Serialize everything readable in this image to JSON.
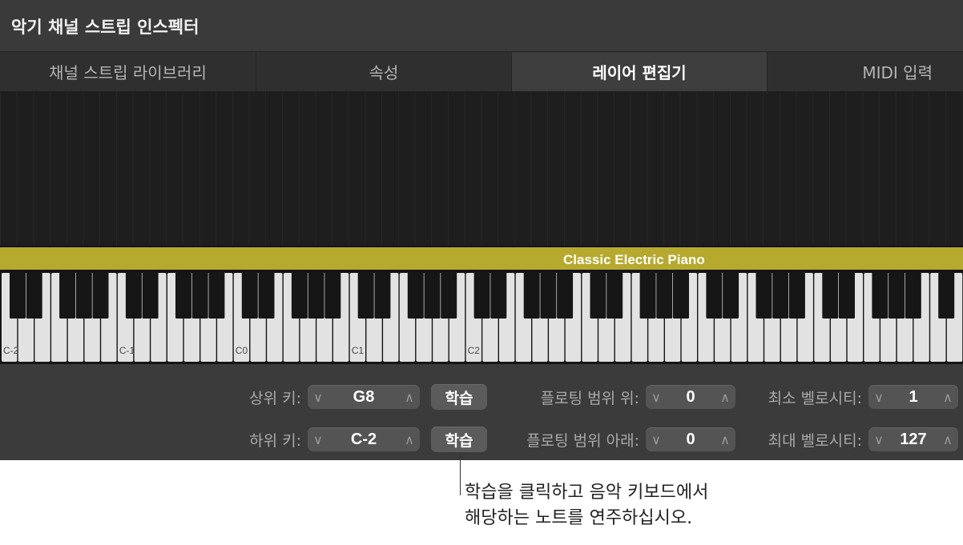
{
  "window": {
    "title": "악기 채널 스트립 인스펙터"
  },
  "tabs": [
    {
      "label": "채널 스트립 라이브러리",
      "active": false
    },
    {
      "label": "속성",
      "active": false
    },
    {
      "label": "레이어 편집기",
      "active": true
    },
    {
      "label": "MIDI 입력",
      "active": false
    }
  ],
  "layer": {
    "name": "Classic Electric Piano",
    "color": "#b7a92e"
  },
  "keyboard": {
    "octave_labels": [
      "C-2",
      "C-1",
      "C0",
      "C1",
      "C2"
    ]
  },
  "controls": {
    "upper_key": {
      "label": "상위 키:",
      "value": "G8"
    },
    "lower_key": {
      "label": "하위 키:",
      "value": "C-2"
    },
    "learn_label": "학습",
    "float_up": {
      "label": "플로팅 범위 위:",
      "value": "0"
    },
    "float_down": {
      "label": "플로팅 범위 아래:",
      "value": "0"
    },
    "min_velocity": {
      "label": "최소 벨로시티:",
      "value": "1"
    },
    "max_velocity": {
      "label": "최대 벨로시티:",
      "value": "127"
    },
    "down_glyph": "∨",
    "up_glyph": "∧"
  },
  "callout": {
    "line1": "학습을 클릭하고 음악 키보드에서",
    "line2": "해당하는 노트를 연주하십시오."
  }
}
